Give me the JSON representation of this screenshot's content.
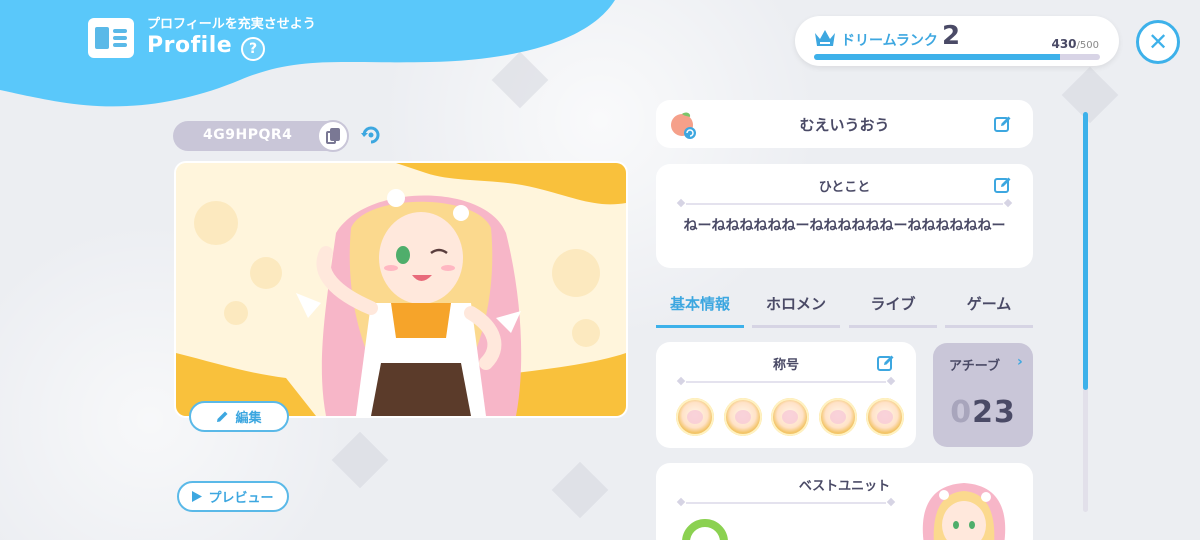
{
  "header": {
    "subtitle": "プロフィールを充実させよう",
    "title": "Profile",
    "help_symbol": "?"
  },
  "rank": {
    "label": "ドリームランク",
    "level": "2",
    "current": "430",
    "max": "/500",
    "progress_fraction": 0.86
  },
  "player": {
    "id": "4G9HPQR4"
  },
  "buttons": {
    "edit_label": "編集",
    "preview_label": "プレビュー"
  },
  "profile": {
    "name": "むえいうおう",
    "comment_title": "ひとこと",
    "comment_text": "ねーねねねねねねーねねねねねねーねねねねねねー"
  },
  "tabs": [
    {
      "label": "基本情報",
      "active": true
    },
    {
      "label": "ホロメン",
      "active": false
    },
    {
      "label": "ライブ",
      "active": false
    },
    {
      "label": "ゲーム",
      "active": false
    }
  ],
  "titles": {
    "label": "称号",
    "badge_count": 5
  },
  "achievements": {
    "label": "アチーブ",
    "count_dim": "0",
    "count": "23"
  },
  "best_unit": {
    "label": "ベストユニット"
  },
  "colors": {
    "accent": "#3db1ea",
    "header_blue": "#5ac8fa",
    "card_bg": "#ffffff",
    "pill_gray": "#c9c6d8"
  }
}
